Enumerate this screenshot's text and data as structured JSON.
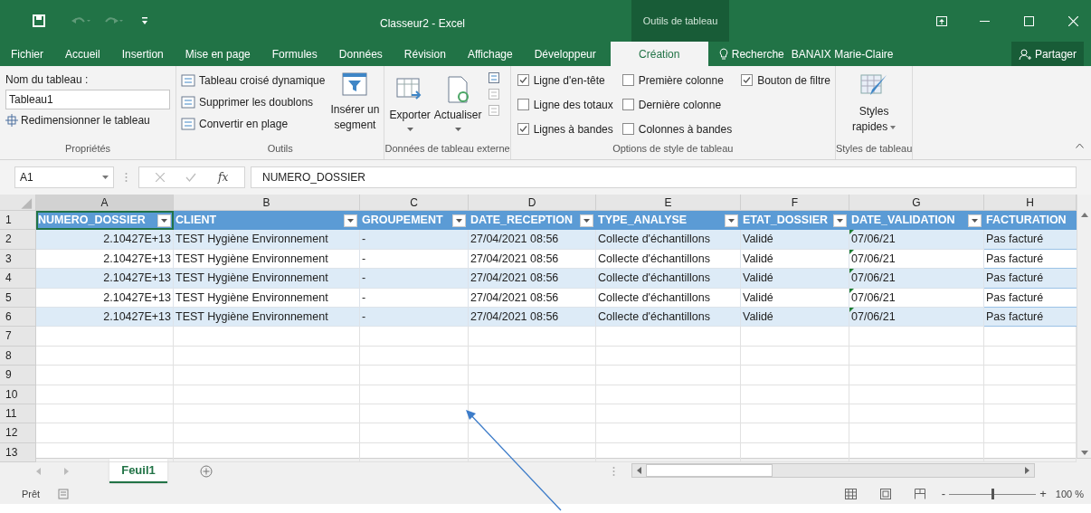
{
  "title_bar": {
    "title": "Classeur2 - Excel",
    "contextual_label": "Outils de tableau"
  },
  "menu_tabs": [
    {
      "label": "Fichier",
      "selected": false
    },
    {
      "label": "Accueil",
      "selected": false
    },
    {
      "label": "Insertion",
      "selected": false
    },
    {
      "label": "Mise en page",
      "selected": false
    },
    {
      "label": "Formules",
      "selected": false
    },
    {
      "label": "Données",
      "selected": false
    },
    {
      "label": "Révision",
      "selected": false
    },
    {
      "label": "Affichage",
      "selected": false
    },
    {
      "label": "Développeur",
      "selected": false
    },
    {
      "label": "Création",
      "selected": true
    }
  ],
  "search": {
    "label": "Recherche"
  },
  "user": "BANAIX Marie-Claire",
  "share_button": "Partager",
  "ribbon": {
    "properties": {
      "name_label": "Nom du tableau :",
      "name_value": "Tableau1",
      "resize": "Redimensionner le tableau",
      "group": "Propriétés"
    },
    "tools": {
      "items": [
        "Tableau croisé dynamique",
        "Supprimer les doublons",
        "Convertir en plage"
      ],
      "slicer": [
        "Insérer un",
        "segment"
      ],
      "group": "Outils"
    },
    "external": {
      "export": "Exporter",
      "refresh": "Actualiser",
      "group": "Données de tableau externe"
    },
    "style_options": {
      "options": [
        {
          "label": "Ligne d'en-tête",
          "checked": true
        },
        {
          "label": "Ligne des totaux",
          "checked": false
        },
        {
          "label": "Lignes à bandes",
          "checked": true
        },
        {
          "label": "Première colonne",
          "checked": false
        },
        {
          "label": "Dernière colonne",
          "checked": false
        },
        {
          "label": "Colonnes à bandes",
          "checked": false
        },
        {
          "label": "Bouton de filtre",
          "checked": true
        }
      ],
      "group": "Options de style de tableau"
    },
    "styles": {
      "quick": [
        "Styles",
        "rapides"
      ],
      "group": "Styles de tableau"
    }
  },
  "formula_bar": {
    "name_box": "A1",
    "function_button": "fx",
    "formula": "NUMERO_DOSSIER"
  },
  "sheet": {
    "columns": [
      {
        "letter": "A",
        "header": "NUMERO_DOSSIER"
      },
      {
        "letter": "B",
        "header": "CLIENT"
      },
      {
        "letter": "C",
        "header": "GROUPEMENT"
      },
      {
        "letter": "D",
        "header": "DATE_RECEPTION"
      },
      {
        "letter": "E",
        "header": "TYPE_ANALYSE"
      },
      {
        "letter": "F",
        "header": "ETAT_DOSSIER"
      },
      {
        "letter": "G",
        "header": "DATE_VALIDATION"
      },
      {
        "letter": "H",
        "header": "FACTURATION"
      }
    ],
    "row_numbers": [
      "1",
      "2",
      "3",
      "4",
      "5",
      "6",
      "7",
      "8",
      "9",
      "10",
      "11",
      "12",
      "13"
    ],
    "rows": [
      [
        "2.10427E+13",
        "TEST Hygiène Environnement",
        "-",
        "27/04/2021 08:56",
        "Collecte d'échantillons",
        "Validé",
        "07/06/21",
        "Pas facturé"
      ],
      [
        "2.10427E+13",
        "TEST Hygiène Environnement",
        "-",
        "27/04/2021 08:56",
        "Collecte d'échantillons",
        "Validé",
        "07/06/21",
        "Pas facturé"
      ],
      [
        "2.10427E+13",
        "TEST Hygiène Environnement",
        "-",
        "27/04/2021 08:56",
        "Collecte d'échantillons",
        "Validé",
        "07/06/21",
        "Pas facturé"
      ],
      [
        "2.10427E+13",
        "TEST Hygiène Environnement",
        "-",
        "27/04/2021 08:56",
        "Collecte d'échantillons",
        "Validé",
        "07/06/21",
        "Pas facturé"
      ],
      [
        "2.10427E+13",
        "TEST Hygiène Environnement",
        "-",
        "27/04/2021 08:56",
        "Collecte d'échantillons",
        "Validé",
        "07/06/21",
        "Pas facturé"
      ]
    ]
  },
  "sheet_tabs": [
    {
      "label": "Feuil1",
      "selected": true
    }
  ],
  "status_bar": {
    "status": "Prêt",
    "zoom_out": "-",
    "zoom_slider": {
      "level": 0.5
    },
    "zoom_in": "+",
    "zoom": "100 %"
  }
}
